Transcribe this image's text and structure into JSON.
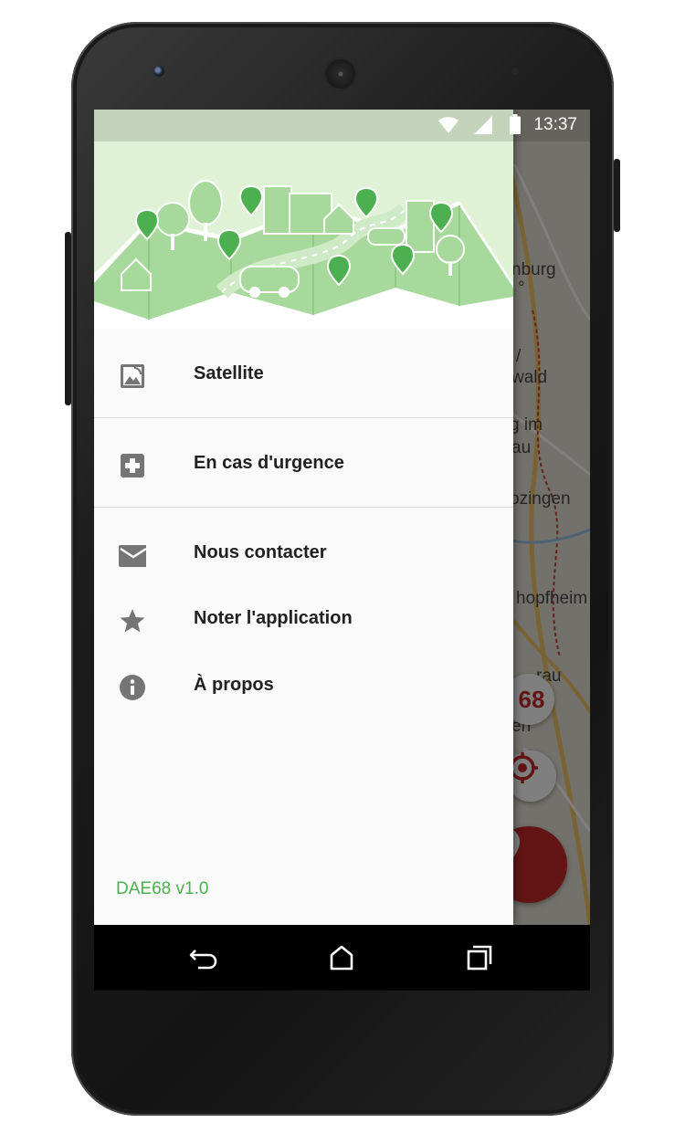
{
  "status_bar": {
    "time": "13:37",
    "icons": [
      "wifi-icon",
      "signal-icon",
      "battery-icon"
    ]
  },
  "map": {
    "labels": [
      "nburg",
      "°",
      "/",
      "wald",
      "g im",
      "au",
      "ozingen",
      "hopfheim",
      "rau",
      "en"
    ],
    "region_badge": "68",
    "accent_color": "#c62828"
  },
  "drawer": {
    "header_image": "city-map-illustration",
    "items": [
      {
        "label": "Satellite",
        "icon": "satellite-image-icon"
      },
      {
        "label": "En cas d'urgence",
        "icon": "first-aid-icon"
      },
      {
        "label": "Nous contacter",
        "icon": "mail-icon"
      },
      {
        "label": "Noter l'application",
        "icon": "star-icon"
      },
      {
        "label": "À propos",
        "icon": "info-icon"
      }
    ],
    "version": "DAE68 v1.0",
    "version_color": "#4caf50"
  },
  "nav_bar": {
    "buttons": [
      "back-icon",
      "home-icon",
      "recents-icon"
    ]
  }
}
